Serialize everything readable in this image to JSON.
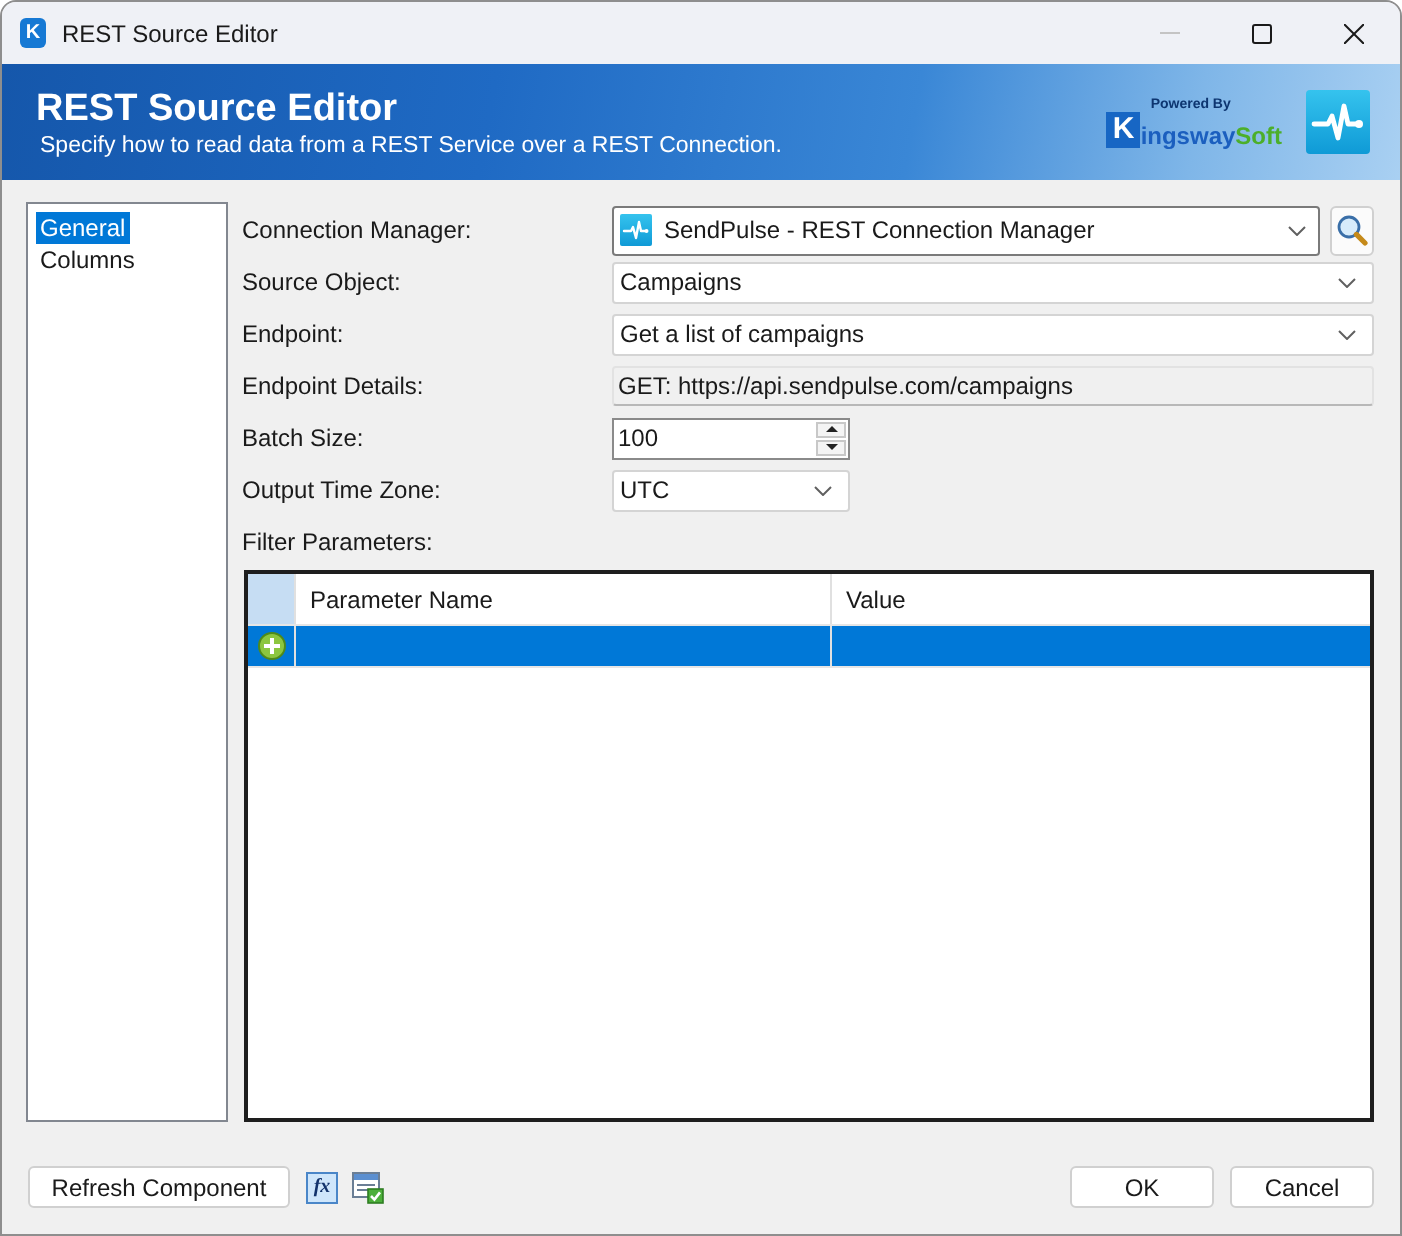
{
  "window": {
    "app_icon": "K",
    "title": "REST Source Editor",
    "minimize_disabled": true
  },
  "header": {
    "title": "REST Source Editor",
    "subtitle": "Specify how to read data from a REST Service over a REST Connection.",
    "logo": {
      "powered_by": "Powered By",
      "initial": "K",
      "name": "ingsway",
      "name_accent": "Soft"
    }
  },
  "sidebar": {
    "items": [
      {
        "label": "General",
        "selected": true
      },
      {
        "label": "Columns",
        "selected": false
      }
    ]
  },
  "form": {
    "fields": [
      {
        "kind": "connection",
        "label": "Connection Manager:",
        "value": "SendPulse - REST Connection Manager"
      },
      {
        "kind": "dropdown",
        "label": "Source Object:",
        "value": "Campaigns"
      },
      {
        "kind": "dropdown",
        "label": "Endpoint:",
        "value": "Get a list of campaigns"
      },
      {
        "kind": "readonly",
        "label": "Endpoint Details:",
        "value": "GET: https://api.sendpulse.com/campaigns"
      },
      {
        "kind": "number",
        "label": "Batch Size:",
        "value": "100"
      },
      {
        "kind": "short_dropdown",
        "label": "Output Time Zone:",
        "value": "UTC"
      }
    ]
  },
  "filter": {
    "label": "Filter Parameters:",
    "columns": [
      "Parameter Name",
      "Value"
    ],
    "rows": [
      {
        "kind": "new",
        "selected": true
      }
    ]
  },
  "footer": {
    "left_button": "Refresh Component",
    "tools": [
      {
        "kind": "expression",
        "glyph": "fx"
      },
      {
        "kind": "table"
      }
    ],
    "buttons": [
      "OK",
      "Cancel"
    ]
  }
}
